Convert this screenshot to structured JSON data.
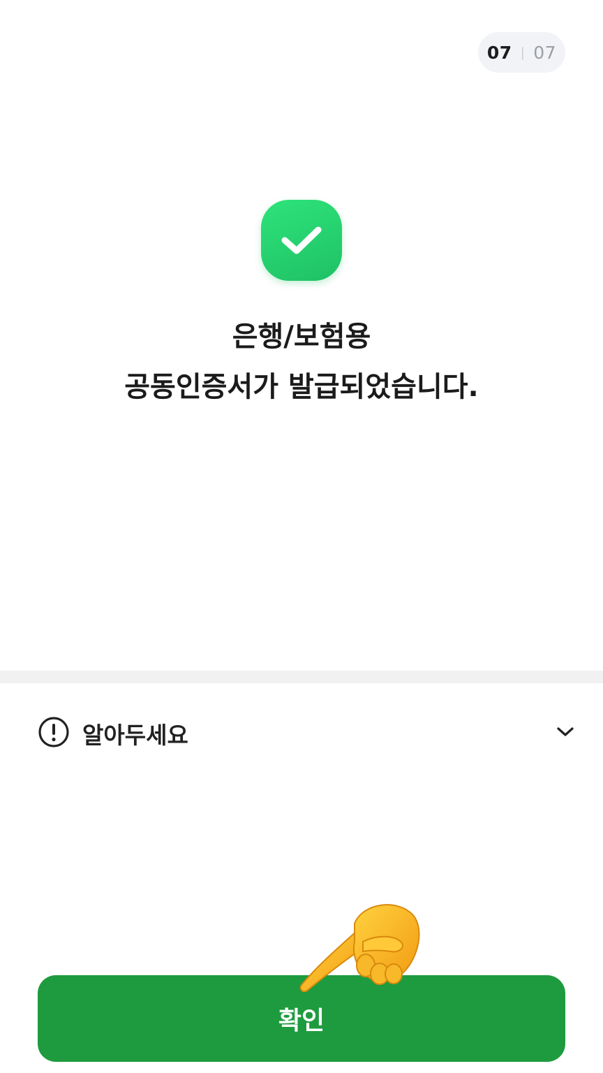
{
  "step": {
    "current": "07",
    "separator": "|",
    "total": "07"
  },
  "result": {
    "line1": "은행/보험용",
    "line2": "공동인증서가 발급되었습니다."
  },
  "notice": {
    "label": "알아두세요",
    "icon": "exclamation-circle-icon",
    "toggle_icon": "chevron-down-icon"
  },
  "confirm_button": {
    "label": "확인"
  },
  "colors": {
    "success_green": "#26d36f",
    "button_green": "#1e9b3e",
    "pill_bg": "#f1f3f6"
  },
  "overlay_icon": "pointing-hand-icon"
}
